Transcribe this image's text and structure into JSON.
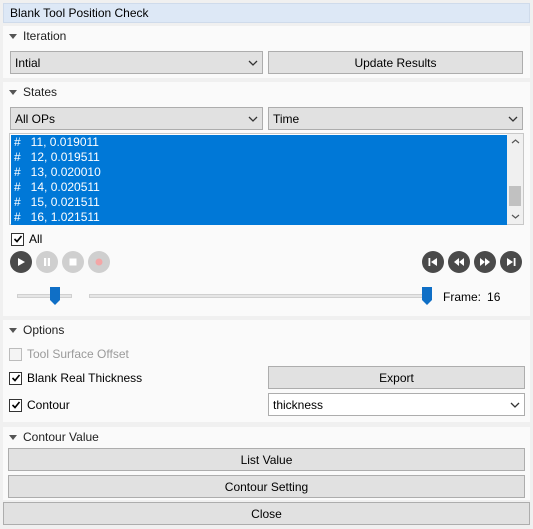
{
  "window": {
    "title": "Blank Tool Position Check"
  },
  "iteration": {
    "header": "Iteration",
    "selected": "Intial",
    "update_label": "Update Results"
  },
  "states": {
    "header": "States",
    "op_selected": "All OPs",
    "time_selected": "Time",
    "items": [
      "#   11, 0.019011",
      "#   12, 0.019511",
      "#   13, 0.020010",
      "#   14, 0.020511",
      "#   15, 0.021511",
      "#   16, 1.021511"
    ],
    "all_label": "All",
    "all_checked": true,
    "frame_label": "Frame:",
    "frame_value": "16"
  },
  "options": {
    "header": "Options",
    "tool_surface_offset_label": "Tool Surface Offset",
    "blank_real_thickness_label": "Blank Real Thickness",
    "contour_label": "Contour",
    "export_label": "Export",
    "contour_type_selected": "thickness"
  },
  "contour_value": {
    "header": "Contour Value",
    "list_value_label": "List Value",
    "contour_setting_label": "Contour Setting"
  },
  "footer": {
    "close_label": "Close"
  },
  "icons": {
    "play": "play-icon",
    "pause": "pause-icon",
    "stop": "stop-icon",
    "record": "record-icon",
    "first": "skip-first-icon",
    "rewind": "rewind-icon",
    "forward": "fast-forward-icon",
    "last": "skip-last-icon"
  },
  "colors": {
    "selection": "#0078d7",
    "slider_thumb": "#0f6fc6",
    "titlebar": "#dde8f6"
  }
}
